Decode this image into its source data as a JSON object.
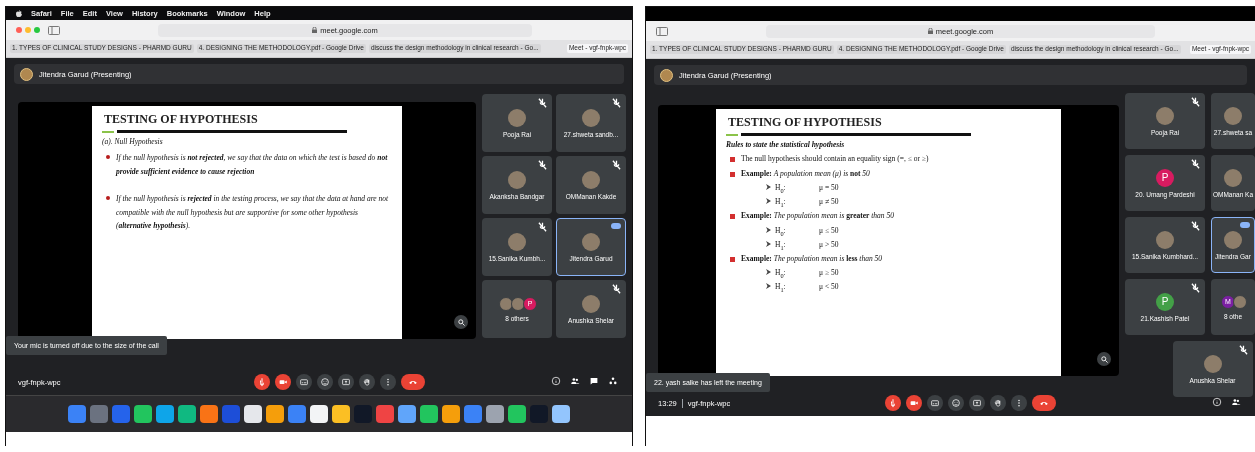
{
  "screens": [
    {
      "menubar": {
        "items": [
          "Safari",
          "File",
          "Edit",
          "View",
          "History",
          "Bookmarks",
          "Window",
          "Help"
        ]
      },
      "browser": {
        "traffic_lights": true,
        "url": "meet.google.com",
        "tabs": [
          {
            "label": "1. TYPES OF CLINICAL STUDY DESIGNS - PHARMD GURU",
            "selected": false
          },
          {
            "label": "4. DESIGNING THE METHODOLOGY.pdf - Google Drive",
            "selected": false
          },
          {
            "label": "discuss the design methodology in clinical research - Go...",
            "selected": false
          },
          {
            "label": "Meet - vgf-fnpk-wpc",
            "selected": true
          }
        ]
      },
      "presenter": "Jitendra Garud (Presenting)",
      "slide": {
        "title": "TESTING OF HYPOTHESIS",
        "subtitle": "(a). Null Hypothesis",
        "items": [
          {
            "kind": "note",
            "text": "If the null hypothesis is **not rejected**, we say that the data on which the test is based do **not provide sufficient evidence to cause rejection**"
          },
          {
            "kind": "note",
            "text": "If the null hypothesis is **rejected** in the testing process, we say that the data at hand are not compatible with the null hypothesis but are supportive for some other hypothesis (**alternative hypothesis**)."
          }
        ]
      },
      "toast": "Your mic is turned off due to the size of the call",
      "tiles": [
        {
          "name": "Pooja Rai",
          "avatar": {
            "kind": "photo"
          },
          "muted": true,
          "selected": false
        },
        {
          "name": "27.shweta sandb...",
          "avatar": {
            "kind": "photo"
          },
          "muted": true,
          "selected": false
        },
        {
          "name": "Akanksha Bandgar",
          "avatar": {
            "kind": "photo"
          },
          "muted": true,
          "selected": false
        },
        {
          "name": "OMManan Kakde",
          "avatar": {
            "kind": "photo"
          },
          "muted": true,
          "selected": false
        },
        {
          "name": "15.Sanika Kumbh...",
          "avatar": {
            "kind": "photo"
          },
          "muted": true,
          "selected": false
        },
        {
          "name": "Jitendra Garud",
          "avatar": {
            "kind": "photo"
          },
          "muted": false,
          "selected": true
        },
        {
          "name": "8 others",
          "avatar": {
            "kind": "group",
            "members": [
              {
                "kind": "photo"
              },
              {
                "kind": "photo"
              },
              {
                "kind": "letter",
                "letter": "P",
                "color": "#d81b60"
              }
            ]
          },
          "muted": false,
          "selected": false
        },
        {
          "name": "Anushka Shelar",
          "avatar": {
            "kind": "photo"
          },
          "muted": true,
          "selected": false
        }
      ],
      "meeting_info": "vgf-fnpk-wpc",
      "controls": [
        {
          "kind": "mic",
          "off": true
        },
        {
          "kind": "camera",
          "off": true
        },
        {
          "kind": "captions",
          "off": false
        },
        {
          "kind": "emoji",
          "off": false
        },
        {
          "kind": "present",
          "off": false
        },
        {
          "kind": "hand",
          "off": false
        },
        {
          "kind": "more",
          "off": false
        },
        {
          "kind": "end",
          "off": true
        }
      ],
      "side_controls": [
        {
          "kind": "info"
        },
        {
          "kind": "people"
        },
        {
          "kind": "chat"
        },
        {
          "kind": "activities"
        }
      ],
      "dock": {
        "apps": [
          {
            "color": "#3b82f6"
          },
          {
            "color": "#6b7280"
          },
          {
            "color": "#2563eb"
          },
          {
            "color": "#22c55e"
          },
          {
            "color": "#0ea5e9"
          },
          {
            "color": "#10b981"
          },
          {
            "color": "#f97316"
          },
          {
            "color": "#1d4ed8"
          },
          {
            "color": "#e5e7eb"
          },
          {
            "color": "#f59e0b"
          },
          {
            "color": "#3b82f6"
          },
          {
            "color": "#f3f4f6"
          },
          {
            "color": "#fbbf24"
          },
          {
            "color": "#111827"
          },
          {
            "color": "#ef4444"
          },
          {
            "color": "#60a5fa"
          },
          {
            "color": "#22c55e"
          },
          {
            "color": "#f59e0b"
          },
          {
            "color": "#3b82f6"
          },
          {
            "color": "#9ca3af"
          },
          {
            "color": "#22c55e"
          },
          {
            "color": "#111827"
          },
          {
            "color": "#93c5fd"
          }
        ]
      }
    },
    {
      "browser": {
        "traffic_lights": false,
        "url": "meet.google.com",
        "tabs": [
          {
            "label": "1. TYPES OF CLINICAL STUDY DESIGNS - PHARMD GURU",
            "selected": false
          },
          {
            "label": "4. DESIGNING THE METHODOLOGY.pdf - Google Drive",
            "selected": false
          },
          {
            "label": "discuss the design methodology in clinical research - Go...",
            "selected": false
          },
          {
            "label": "Meet - vgf-fnpk-wpc",
            "selected": true
          }
        ]
      },
      "presenter": "Jitendra Garud (Presenting)",
      "slide": {
        "title": "TESTING OF HYPOTHESIS",
        "subtitle": "Rules to state the statistical hypothesis",
        "items": [
          {
            "kind": "bullet",
            "text": "The null hypothesis should contain an equality sign (=, ≤ or ≥)"
          },
          {
            "kind": "bullet",
            "text": "**Example:** *A population mean (μ) is* **not** *50*"
          },
          {
            "kind": "sub",
            "label": "H$_{0}$:",
            "value": "μ = 50"
          },
          {
            "kind": "sub",
            "label": "H$_{1}$:",
            "value": "μ ≠ 50"
          },
          {
            "kind": "bullet",
            "text": "**Example:** *The population mean is* **greater** *than 50*"
          },
          {
            "kind": "sub",
            "label": "H$_{0}$:",
            "value": "μ ≤ 50"
          },
          {
            "kind": "sub",
            "label": "H$_{1}$:",
            "value": "μ > 50"
          },
          {
            "kind": "bullet",
            "text": "**Example:** *The population mean is* **less** *than 50*"
          },
          {
            "kind": "sub",
            "label": "H$_{0}$:",
            "value": "μ ≥ 50"
          },
          {
            "kind": "sub",
            "label": "H$_{1}$:",
            "value": "μ < 50"
          }
        ]
      },
      "toast": "22. yash salke has left the meeting",
      "tiles": [
        {
          "name": "Pooja Rai",
          "avatar": {
            "kind": "photo"
          },
          "muted": true,
          "selected": false
        },
        {
          "name": "27.shweta sa",
          "avatar": {
            "kind": "photo"
          },
          "muted": false,
          "selected": false
        },
        {
          "name": "20. Umang Pardeshi",
          "avatar": {
            "kind": "letter",
            "letter": "P",
            "color": "#d81b60"
          },
          "muted": true,
          "selected": false
        },
        {
          "name": "OMManan Ka",
          "avatar": {
            "kind": "photo"
          },
          "muted": false,
          "selected": false
        },
        {
          "name": "15.Sanika Kumbhard...",
          "avatar": {
            "kind": "photo"
          },
          "muted": true,
          "selected": false
        },
        {
          "name": "Jitendra Gar",
          "avatar": {
            "kind": "photo"
          },
          "muted": false,
          "selected": true
        },
        {
          "name": "21.Kashish Patel",
          "avatar": {
            "kind": "letter",
            "letter": "P",
            "color": "#43a047"
          },
          "muted": true,
          "selected": false
        },
        {
          "name": "8 othe",
          "avatar": {
            "kind": "group",
            "members": [
              {
                "kind": "letter",
                "letter": "M",
                "color": "#7b1fa2"
              },
              {
                "kind": "photo"
              }
            ]
          },
          "muted": false,
          "selected": false
        },
        {
          "name": "Anushka Shelar",
          "avatar": {
            "kind": "photo"
          },
          "muted": true,
          "selected": false
        }
      ],
      "clock": "13:29",
      "meeting_info": "vgf-fnpk-wpc",
      "controls": [
        {
          "kind": "mic",
          "off": true
        },
        {
          "kind": "camera",
          "off": true
        },
        {
          "kind": "captions",
          "off": false
        },
        {
          "kind": "emoji",
          "off": false
        },
        {
          "kind": "present",
          "off": false
        },
        {
          "kind": "hand",
          "off": false
        },
        {
          "kind": "more",
          "off": false
        },
        {
          "kind": "end",
          "off": true
        }
      ],
      "side_controls": [
        {
          "kind": "info"
        },
        {
          "kind": "people"
        }
      ]
    }
  ]
}
